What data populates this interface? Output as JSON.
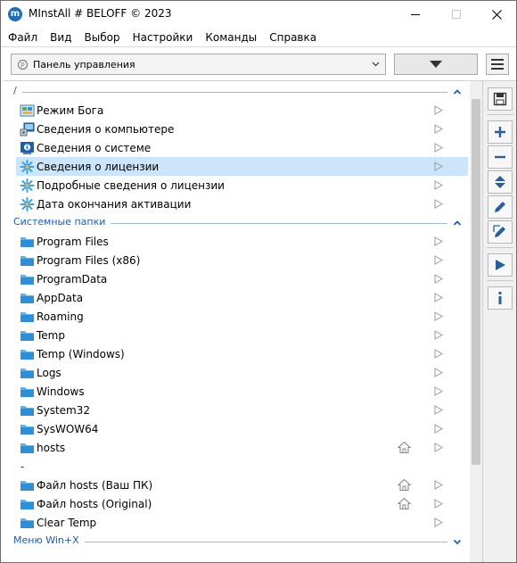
{
  "window": {
    "title": "MInstAll # BELOFF © 2023",
    "app_icon_glyph": "m"
  },
  "menu": [
    "Файл",
    "Вид",
    "Выбор",
    "Настройки",
    "Команды",
    "Справка"
  ],
  "toolbar": {
    "combo_value": "Панель управления",
    "combo_icon_glyph": "p"
  },
  "groups": [
    {
      "title": "/",
      "expanded": true,
      "items": [
        {
          "label": "Режим Бога",
          "icon": "control-panel-icon",
          "selected": false
        },
        {
          "label": "Сведения о компьютере",
          "icon": "computer-info-icon",
          "selected": false
        },
        {
          "label": "Сведения о системе",
          "icon": "system-info-icon",
          "selected": false
        },
        {
          "label": "Сведения о лицензии",
          "icon": "license-icon",
          "selected": true
        },
        {
          "label": "Подробные сведения о лицензии",
          "icon": "license-icon",
          "selected": false
        },
        {
          "label": "Дата окончания активации",
          "icon": "license-icon",
          "selected": false
        }
      ]
    },
    {
      "title": "Системные папки",
      "expanded": true,
      "items": [
        {
          "label": "Program Files",
          "icon": "folder-icon"
        },
        {
          "label": "Program Files (x86)",
          "icon": "folder-icon"
        },
        {
          "label": "ProgramData",
          "icon": "folder-icon"
        },
        {
          "label": "AppData",
          "icon": "folder-icon"
        },
        {
          "label": "Roaming",
          "icon": "folder-icon"
        },
        {
          "label": "Temp",
          "icon": "folder-icon"
        },
        {
          "label": "Temp (Windows)",
          "icon": "folder-icon"
        },
        {
          "label": "Logs",
          "icon": "folder-icon"
        },
        {
          "label": "Windows",
          "icon": "folder-icon"
        },
        {
          "label": "System32",
          "icon": "folder-icon"
        },
        {
          "label": "SysWOW64",
          "icon": "folder-icon"
        },
        {
          "label": "hosts",
          "icon": "folder-icon",
          "home": true
        },
        {
          "label": "-",
          "separator": true
        },
        {
          "label": "Файл hosts (Ваш ПК)",
          "icon": "folder-icon",
          "home": true
        },
        {
          "label": "Файл hosts (Original)",
          "icon": "folder-icon",
          "home": true
        },
        {
          "label": "Clear Temp",
          "icon": "folder-icon"
        }
      ]
    },
    {
      "title": "Меню Win+X",
      "expanded": false,
      "items": []
    }
  ],
  "tools": [
    "save-icon",
    "add-icon",
    "remove-icon",
    "move-updown-icon",
    "edit-icon",
    "edit-alt-icon",
    "run-icon",
    "info-icon"
  ],
  "colors": {
    "accent": "#1e5ea8",
    "selection": "#cce5fa",
    "folder": "#3a9ad9"
  }
}
